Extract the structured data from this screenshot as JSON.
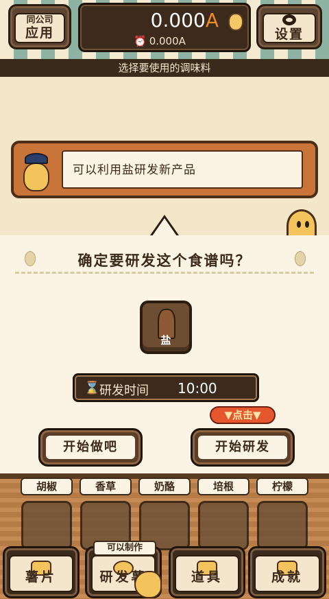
{
  "topbar": {
    "company_tag": "同公司",
    "company_label": "应用",
    "money_main_value": "0.000",
    "money_main_unit": "A",
    "money_sub": "0.000A",
    "settings_label": "设置"
  },
  "hint": "选择要使用的调味料",
  "speech": "可以利用盐研发新产品",
  "dialog": {
    "title": "确定要研发这个食谱吗？",
    "ingredient": "盐",
    "time_label": "研发时间",
    "time_value": "10:00",
    "badge": "▼点击▼",
    "btn_do": "开始做吧",
    "btn_dev": "开始研发"
  },
  "seasonings": [
    "胡椒",
    "香草",
    "奶酪",
    "培根",
    "柠檬"
  ],
  "bottom_nav": {
    "can_make": "可以制作",
    "chips": "薯片",
    "dev": "研发薯",
    "tools": "道具",
    "achievements": "成就"
  },
  "colors": {
    "accent": "#f08a22",
    "dark": "#3c2a1c",
    "cream": "#fbf4e5",
    "badge": "#e5562d"
  }
}
